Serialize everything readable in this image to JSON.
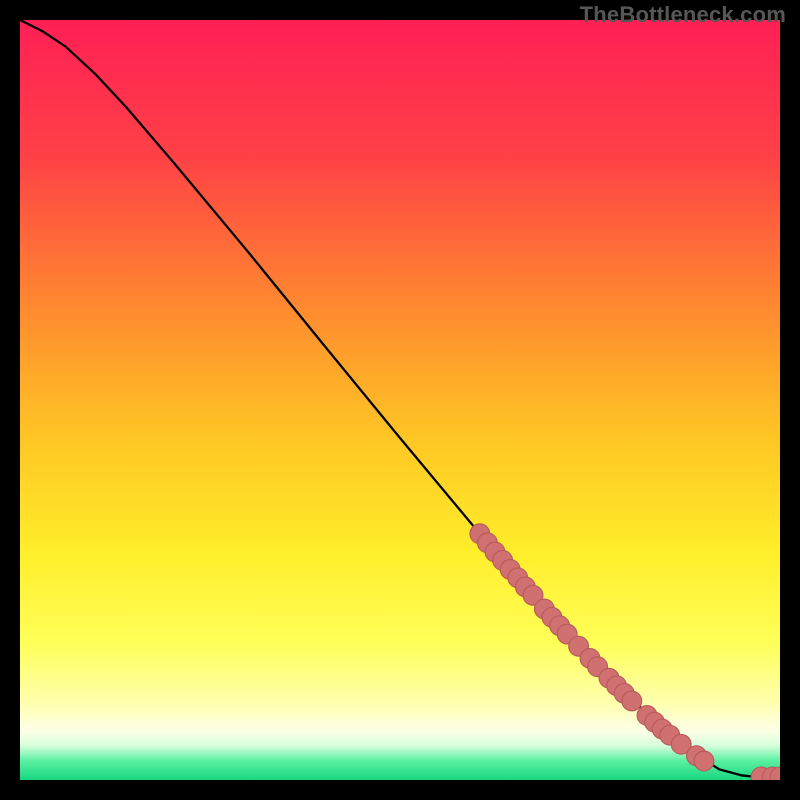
{
  "watermark": "TheBottleneck.com",
  "colors": {
    "background": "#000000",
    "curve": "#000000",
    "marker_fill": "#d07070",
    "marker_stroke": "#b85a5a",
    "gradient_stops": [
      {
        "offset": 0.0,
        "color": "#ff1f55"
      },
      {
        "offset": 0.18,
        "color": "#ff4146"
      },
      {
        "offset": 0.38,
        "color": "#ff8a2f"
      },
      {
        "offset": 0.55,
        "color": "#ffc624"
      },
      {
        "offset": 0.7,
        "color": "#ffee2a"
      },
      {
        "offset": 0.82,
        "color": "#ffff59"
      },
      {
        "offset": 0.9,
        "color": "#ffffb0"
      },
      {
        "offset": 0.935,
        "color": "#fdffe6"
      },
      {
        "offset": 0.955,
        "color": "#d6ffdc"
      },
      {
        "offset": 0.975,
        "color": "#5af0a0"
      },
      {
        "offset": 1.0,
        "color": "#17d780"
      }
    ]
  },
  "chart_data": {
    "type": "line",
    "title": "",
    "xlabel": "",
    "ylabel": "",
    "xlim": [
      0,
      100
    ],
    "ylim": [
      0,
      100
    ],
    "curve": {
      "name": "bottleneck-curve",
      "points": [
        {
          "x": 0,
          "y": 100
        },
        {
          "x": 3,
          "y": 98.5
        },
        {
          "x": 6,
          "y": 96.5
        },
        {
          "x": 10,
          "y": 92.8
        },
        {
          "x": 14,
          "y": 88.5
        },
        {
          "x": 20,
          "y": 81.5
        },
        {
          "x": 30,
          "y": 69.5
        },
        {
          "x": 40,
          "y": 57.2
        },
        {
          "x": 50,
          "y": 45.0
        },
        {
          "x": 60,
          "y": 33.0
        },
        {
          "x": 70,
          "y": 21.5
        },
        {
          "x": 80,
          "y": 11.0
        },
        {
          "x": 88,
          "y": 4.0
        },
        {
          "x": 92,
          "y": 1.4
        },
        {
          "x": 95,
          "y": 0.6
        },
        {
          "x": 97,
          "y": 0.4
        },
        {
          "x": 100,
          "y": 0.4
        }
      ]
    },
    "markers": {
      "name": "highlighted-points",
      "radius": 1.3,
      "points": [
        {
          "x": 60.5,
          "y": 32.4
        },
        {
          "x": 61.5,
          "y": 31.2
        },
        {
          "x": 62.5,
          "y": 30.0
        },
        {
          "x": 63.5,
          "y": 28.9
        },
        {
          "x": 64.5,
          "y": 27.7
        },
        {
          "x": 65.5,
          "y": 26.6
        },
        {
          "x": 66.5,
          "y": 25.4
        },
        {
          "x": 67.5,
          "y": 24.3
        },
        {
          "x": 69.0,
          "y": 22.5
        },
        {
          "x": 70.0,
          "y": 21.4
        },
        {
          "x": 71.0,
          "y": 20.3
        },
        {
          "x": 72.0,
          "y": 19.2
        },
        {
          "x": 73.5,
          "y": 17.6
        },
        {
          "x": 75.0,
          "y": 16.0
        },
        {
          "x": 76.0,
          "y": 14.9
        },
        {
          "x": 77.5,
          "y": 13.4
        },
        {
          "x": 78.5,
          "y": 12.4
        },
        {
          "x": 79.5,
          "y": 11.4
        },
        {
          "x": 80.5,
          "y": 10.4
        },
        {
          "x": 82.5,
          "y": 8.5
        },
        {
          "x": 83.5,
          "y": 7.6
        },
        {
          "x": 84.5,
          "y": 6.7
        },
        {
          "x": 85.5,
          "y": 5.9
        },
        {
          "x": 87.0,
          "y": 4.7
        },
        {
          "x": 89.0,
          "y": 3.2
        },
        {
          "x": 90.0,
          "y": 2.5
        },
        {
          "x": 97.5,
          "y": 0.4
        },
        {
          "x": 99.0,
          "y": 0.4
        },
        {
          "x": 100.0,
          "y": 0.4
        }
      ]
    }
  }
}
